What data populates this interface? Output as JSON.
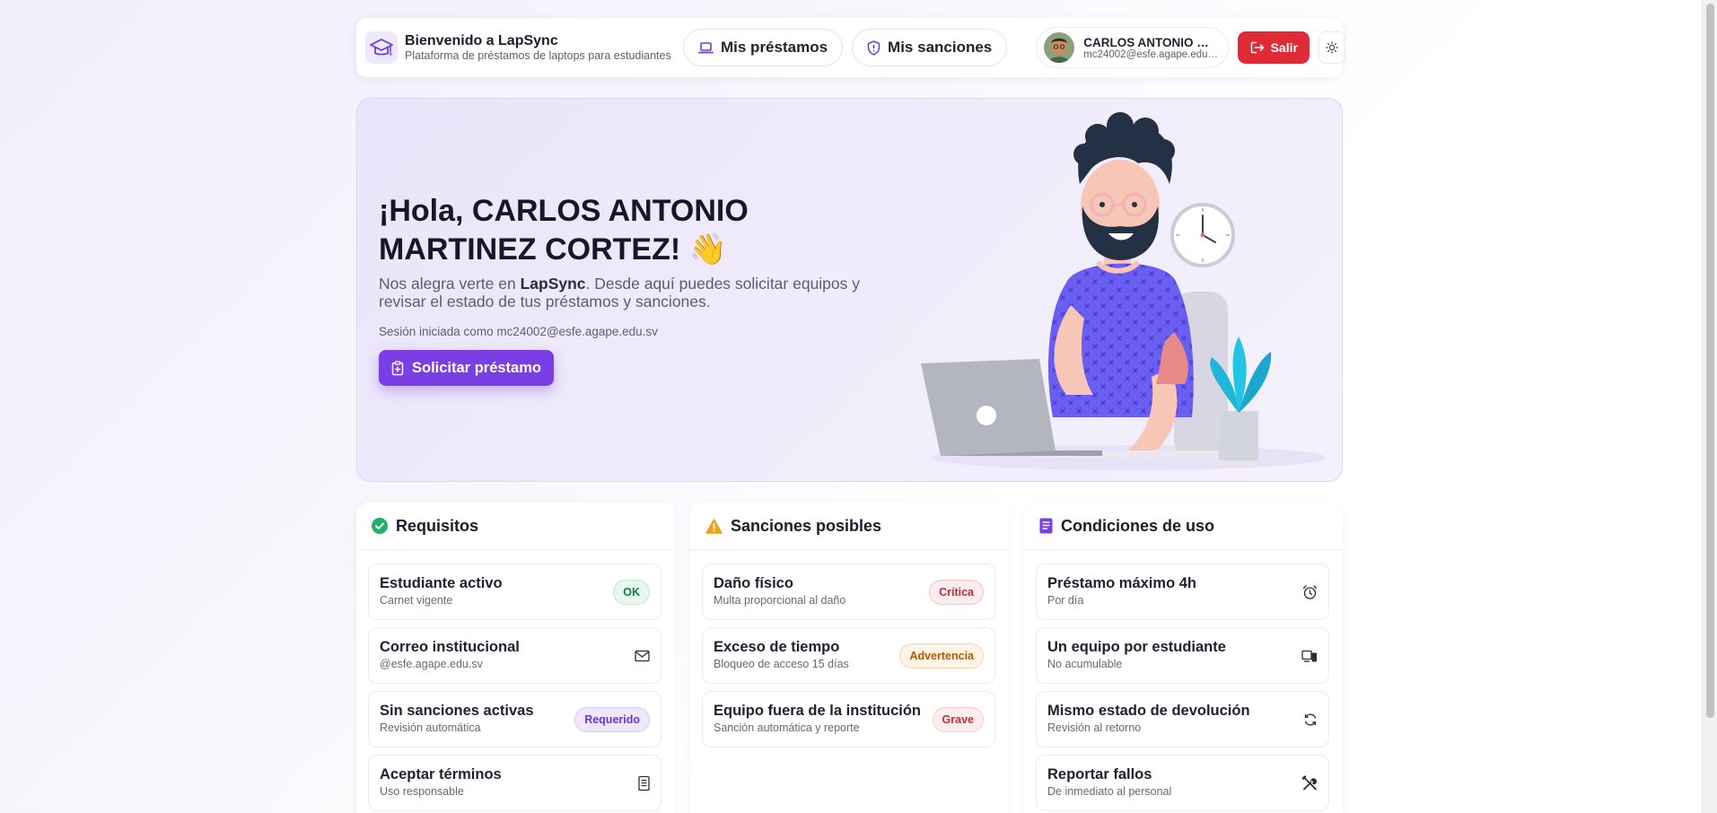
{
  "header": {
    "brand_title": "Bienvenido a LapSync",
    "brand_subtitle": "Plataforma de préstamos de laptops para estudiantes",
    "nav": [
      {
        "label": "Mis préstamos",
        "icon": "laptop-icon"
      },
      {
        "label": "Mis sanciones",
        "icon": "shield-alert-icon"
      }
    ],
    "user": {
      "name": "CARLOS ANTONIO MARTINEZ CORTEZ",
      "email": "mc24002@esfe.agape.edu.sv"
    },
    "logout_label": "Salir",
    "theme_icon": "sun-icon"
  },
  "hero": {
    "title": "¡Hola, CARLOS ANTONIO MARTINEZ CORTEZ! 👋",
    "desc_prefix": "Nos alegra verte en ",
    "desc_brand": "LapSync",
    "desc_suffix": ". Desde aquí puedes solicitar equipos y revisar el estado de tus préstamos y sanciones.",
    "session": "Sesión iniciada como mc24002@esfe.agape.edu.sv",
    "cta_label": "Solicitar préstamo"
  },
  "cards": {
    "requisitos": {
      "title": "Requisitos",
      "icon": "check-circle-icon",
      "items": [
        {
          "title": "Estudiante activo",
          "sub": "Carnet vigente",
          "badge": "OK"
        },
        {
          "title": "Correo institucional",
          "sub": "@esfe.agape.edu.sv",
          "icon": "mail-icon"
        },
        {
          "title": "Sin sanciones activas",
          "sub": "Revisión automática",
          "badge": "Requerido"
        },
        {
          "title": "Aceptar términos",
          "sub": "Uso responsable",
          "icon": "document-icon"
        }
      ]
    },
    "sanciones": {
      "title": "Sanciones posibles",
      "icon": "warning-icon",
      "items": [
        {
          "title": "Daño físico",
          "sub": "Multa proporcional al daño",
          "badge": "Crítica"
        },
        {
          "title": "Exceso de tiempo",
          "sub": "Bloqueo de acceso 15 días",
          "badge": "Advertencia"
        },
        {
          "title": "Equipo fuera de la institución",
          "sub": "Sanción automática y reporte",
          "badge": "Grave"
        }
      ]
    },
    "condiciones": {
      "title": "Condiciones de uso",
      "icon": "document-purple-icon",
      "items": [
        {
          "title": "Préstamo máximo 4h",
          "sub": "Por día",
          "icon": "alarm-clock-icon"
        },
        {
          "title": "Un equipo por estudiante",
          "sub": "No acumulable",
          "icon": "devices-icon"
        },
        {
          "title": "Mismo estado de devolución",
          "sub": "Revisión al retorno",
          "icon": "refresh-icon"
        },
        {
          "title": "Reportar fallos",
          "sub": "De inmediato al personal",
          "icon": "tools-icon"
        }
      ]
    }
  },
  "colors": {
    "accent": "#7a3ee5",
    "danger": "#e02b36",
    "success": "#22b36b",
    "warning": "#f0a020"
  }
}
